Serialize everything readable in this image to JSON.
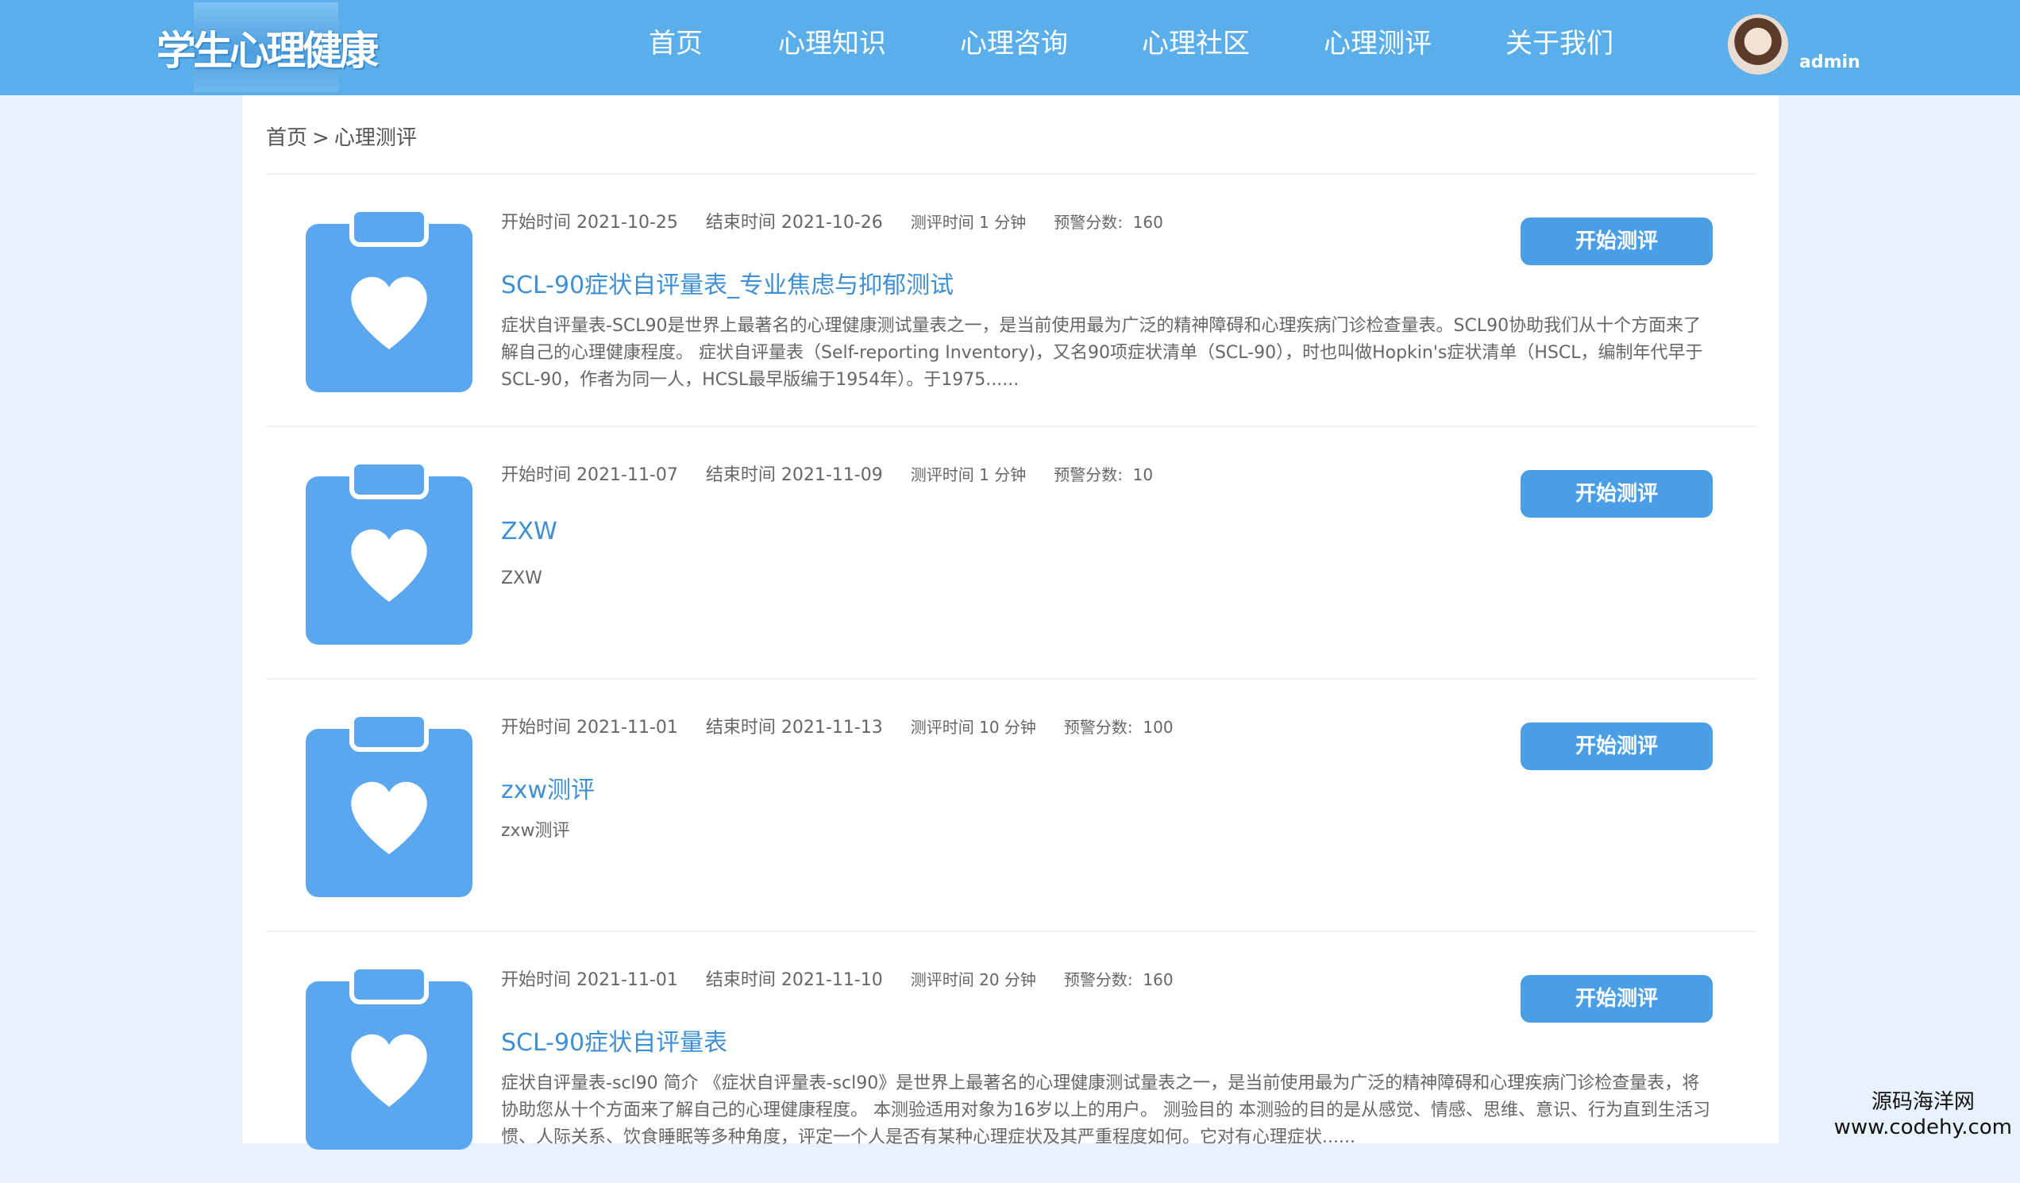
{
  "header": {
    "logo_text": "学生心理健康",
    "nav": [
      {
        "label": "首页"
      },
      {
        "label": "心理知识"
      },
      {
        "label": "心理咨询"
      },
      {
        "label": "心理社区"
      },
      {
        "label": "心理测评"
      },
      {
        "label": "关于我们"
      }
    ],
    "username": "admin"
  },
  "breadcrumb": {
    "home": "首页",
    "separator": ">",
    "current": "心理测评"
  },
  "colors": {
    "header": "#5aaeea",
    "accent": "#4a9ee6",
    "title": "#3f8fd4",
    "background": "#e8f2fc"
  },
  "assessments": [
    {
      "start_label": "开始时间",
      "start": "2021-10-25",
      "end_label": "结束时间",
      "end": "2021-10-26",
      "duration_label": "测评时间",
      "duration": "1 分钟",
      "warn_label": "预警分数:",
      "warn": "160",
      "title": "SCL-90症状自评量表_专业焦虑与抑郁测试",
      "description": "症状自评量表-SCL90是世界上最著名的心理健康测试量表之一，是当前使用最为广泛的精神障碍和心理疾病门诊检查量表。SCL90协助我们从十个方面来了解自己的心理健康程度。 症状自评量表（Self-reporting Inventory)，又名90项症状清单（SCL-90），时也叫做Hopkin's症状清单（HSCL，编制年代早于SCL-90，作者为同一人，HCSL最早版编于1954年）。于1975......",
      "button": "开始测评",
      "icon": "clipboard-heart-icon"
    },
    {
      "start_label": "开始时间",
      "start": "2021-11-07",
      "end_label": "结束时间",
      "end": "2021-11-09",
      "duration_label": "测评时间",
      "duration": "1 分钟",
      "warn_label": "预警分数:",
      "warn": "10",
      "title": "ZXW",
      "description": "ZXW",
      "button": "开始测评",
      "icon": "clipboard-heart-icon"
    },
    {
      "start_label": "开始时间",
      "start": "2021-11-01",
      "end_label": "结束时间",
      "end": "2021-11-13",
      "duration_label": "测评时间",
      "duration": "10 分钟",
      "warn_label": "预警分数:",
      "warn": "100",
      "title": "zxw测评",
      "description": "zxw测评",
      "button": "开始测评",
      "icon": "clipboard-heart-icon"
    },
    {
      "start_label": "开始时间",
      "start": "2021-11-01",
      "end_label": "结束时间",
      "end": "2021-11-10",
      "duration_label": "测评时间",
      "duration": "20 分钟",
      "warn_label": "预警分数:",
      "warn": "160",
      "title": "SCL-90症状自评量表",
      "description": "症状自评量表-scl90 简介 《症状自评量表-scl90》是世界上最著名的心理健康测试量表之一，是当前使用最为广泛的精神障碍和心理疾病门诊检查量表，将协助您从十个方面来了解自己的心理健康程度。 本测验适用对象为16岁以上的用户。 测验目的 本测验的目的是从感觉、情感、思维、意识、行为直到生活习惯、人际关系、饮食睡眠等多种角度，评定一个人是否有某种心理症状及其严重程度如何。它对有心理症状......",
      "button": "开始测评",
      "icon": "clipboard-heart-icon"
    }
  ],
  "watermark": {
    "line1": "源码海洋网",
    "line2": "www.codehy.com"
  }
}
